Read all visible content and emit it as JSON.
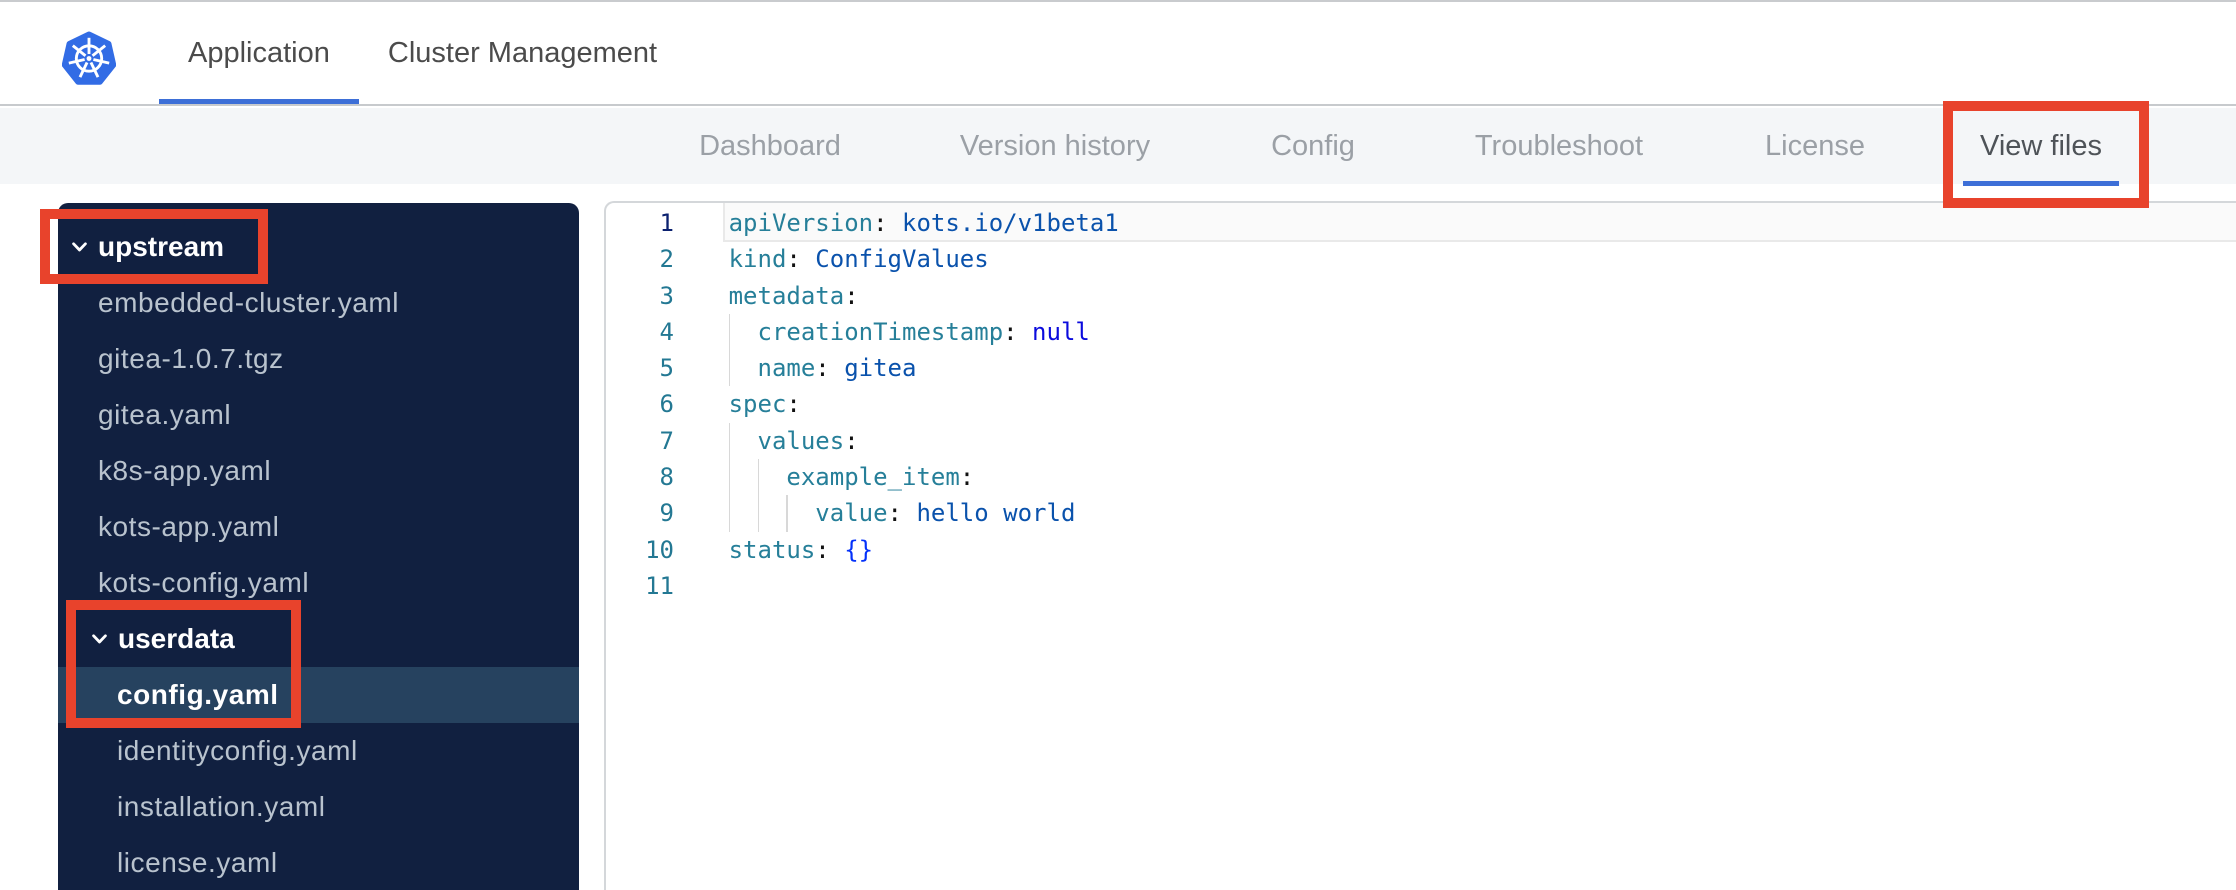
{
  "colors": {
    "accent_blue": "#3d6fd7",
    "logo_blue": "#326ce5",
    "annotation_red": "#e8432c",
    "sidebar_bg": "#112040",
    "sidebar_selected_bg": "#26425f",
    "token_key": "#267f99",
    "token_punct": "#111111",
    "token_value": "#0a52ac",
    "token_keyword": "#0b0bdd",
    "token_bracket": "#0431fa",
    "line_number": "#237893",
    "line_number_active": "#0b216f"
  },
  "header": {
    "tabs": [
      {
        "label": "Application",
        "active": true
      },
      {
        "label": "Cluster Management",
        "active": false
      }
    ]
  },
  "subnav": {
    "tabs": [
      {
        "label": "Dashboard",
        "active": false
      },
      {
        "label": "Version history",
        "active": false
      },
      {
        "label": "Config",
        "active": false
      },
      {
        "label": "Troubleshoot",
        "active": false
      },
      {
        "label": "License",
        "active": false
      },
      {
        "label": "View files",
        "active": true
      }
    ]
  },
  "file_tree": {
    "items": [
      {
        "label": "upstream",
        "type": "folder",
        "depth": 0,
        "expanded": true
      },
      {
        "label": "embedded-cluster.yaml",
        "type": "file",
        "depth": 1
      },
      {
        "label": "gitea-1.0.7.tgz",
        "type": "file",
        "depth": 1
      },
      {
        "label": "gitea.yaml",
        "type": "file",
        "depth": 1
      },
      {
        "label": "k8s-app.yaml",
        "type": "file",
        "depth": 1
      },
      {
        "label": "kots-app.yaml",
        "type": "file",
        "depth": 1
      },
      {
        "label": "kots-config.yaml",
        "type": "file",
        "depth": 1
      },
      {
        "label": "userdata",
        "type": "folder",
        "depth": 1,
        "expanded": true
      },
      {
        "label": "config.yaml",
        "type": "file",
        "depth": 2,
        "selected": true
      },
      {
        "label": "identityconfig.yaml",
        "type": "file",
        "depth": 2
      },
      {
        "label": "installation.yaml",
        "type": "file",
        "depth": 2
      },
      {
        "label": "license.yaml",
        "type": "file",
        "depth": 2
      }
    ]
  },
  "editor": {
    "language": "yaml",
    "active_line": 1,
    "lines": [
      {
        "num": 1,
        "indent": 0,
        "tokens": [
          [
            "key",
            "apiVersion"
          ],
          [
            "punct",
            ":"
          ],
          [
            "plain",
            " "
          ],
          [
            "value",
            "kots.io/v1beta1"
          ]
        ]
      },
      {
        "num": 2,
        "indent": 0,
        "tokens": [
          [
            "key",
            "kind"
          ],
          [
            "punct",
            ":"
          ],
          [
            "plain",
            " "
          ],
          [
            "value",
            "ConfigValues"
          ]
        ]
      },
      {
        "num": 3,
        "indent": 0,
        "tokens": [
          [
            "key",
            "metadata"
          ],
          [
            "punct",
            ":"
          ]
        ]
      },
      {
        "num": 4,
        "indent": 2,
        "tokens": [
          [
            "key",
            "creationTimestamp"
          ],
          [
            "punct",
            ":"
          ],
          [
            "plain",
            " "
          ],
          [
            "keyword",
            "null"
          ]
        ]
      },
      {
        "num": 5,
        "indent": 2,
        "tokens": [
          [
            "key",
            "name"
          ],
          [
            "punct",
            ":"
          ],
          [
            "plain",
            " "
          ],
          [
            "value",
            "gitea"
          ]
        ]
      },
      {
        "num": 6,
        "indent": 0,
        "tokens": [
          [
            "key",
            "spec"
          ],
          [
            "punct",
            ":"
          ]
        ]
      },
      {
        "num": 7,
        "indent": 2,
        "tokens": [
          [
            "key",
            "values"
          ],
          [
            "punct",
            ":"
          ]
        ]
      },
      {
        "num": 8,
        "indent": 4,
        "tokens": [
          [
            "key",
            "example_item"
          ],
          [
            "punct",
            ":"
          ]
        ]
      },
      {
        "num": 9,
        "indent": 6,
        "tokens": [
          [
            "key",
            "value"
          ],
          [
            "punct",
            ":"
          ],
          [
            "plain",
            " "
          ],
          [
            "value",
            "hello world"
          ]
        ]
      },
      {
        "num": 10,
        "indent": 0,
        "tokens": [
          [
            "key",
            "status"
          ],
          [
            "punct",
            ":"
          ],
          [
            "plain",
            " "
          ],
          [
            "bracket",
            "{}"
          ]
        ]
      },
      {
        "num": 11,
        "indent": 0,
        "tokens": []
      }
    ]
  },
  "annotations": [
    {
      "target": "view-files-tab"
    },
    {
      "target": "upstream-folder"
    },
    {
      "target": "userdata-config-selection"
    }
  ]
}
